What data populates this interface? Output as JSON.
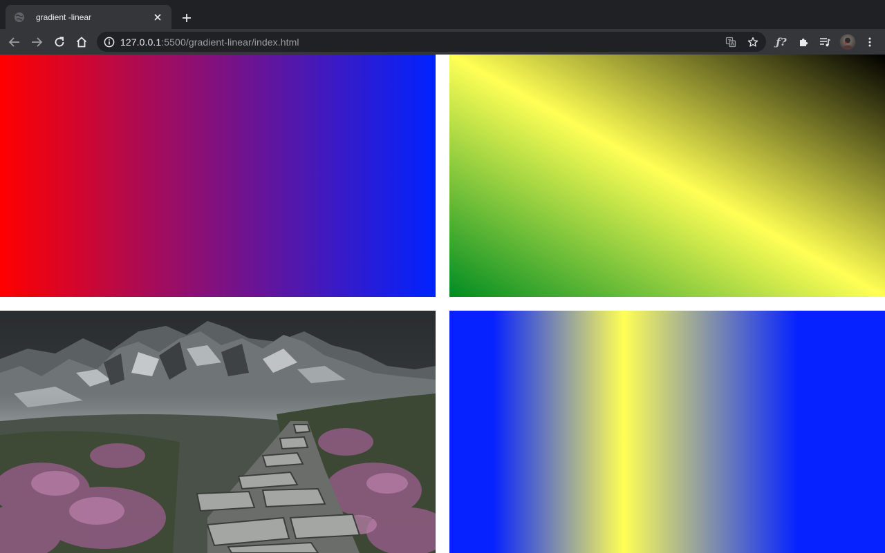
{
  "browser": {
    "tab": {
      "title": "gradient -linear",
      "favicon": "globe-icon",
      "close_icon": "close-icon"
    },
    "new_tab_icon": "plus-icon",
    "nav": {
      "back_icon": "arrow-left-icon",
      "forward_icon": "arrow-right-icon",
      "reload_icon": "reload-icon",
      "home_icon": "home-icon"
    },
    "address": {
      "info_icon": "info-icon",
      "host": "127.0.0.1",
      "rest": ":5500/gradient-linear/index.html"
    },
    "omnibox_actions": {
      "translate_icon": "translate-icon",
      "bookmark_icon": "star-icon"
    },
    "extensions": {
      "fx_label": "ƒ?",
      "puzzle_icon": "puzzle-icon",
      "media_icon": "media-queue-icon",
      "profile_icon": "avatar",
      "menu_icon": "kebab-menu-icon"
    }
  },
  "page": {
    "boxes": [
      {
        "id": "gradient-red-blue",
        "colors": [
          "#ff0000",
          "#0022ff"
        ],
        "direction": "to right"
      },
      {
        "id": "gradient-green-yellow-black",
        "colors": [
          "#008c22",
          "#ffff55",
          "#000000"
        ],
        "direction": "to top right"
      },
      {
        "id": "landscape-image",
        "subject": "mountain stone path with heather"
      },
      {
        "id": "gradient-blue-yellow-blue",
        "colors": [
          "#0622ff",
          "#ffff55",
          "#0622ff"
        ],
        "direction": "to right"
      }
    ]
  }
}
